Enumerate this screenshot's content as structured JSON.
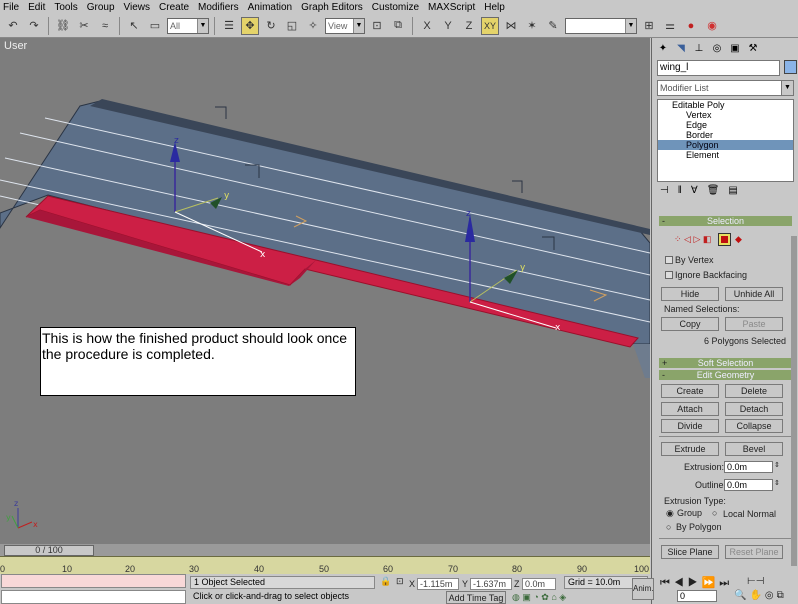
{
  "menu": [
    "File",
    "Edit",
    "Tools",
    "Group",
    "Views",
    "Create",
    "Modifiers",
    "Animation",
    "Graph Editors",
    "Customize",
    "MAXScript",
    "Help"
  ],
  "toolbar": {
    "selection_filter": "All",
    "ref_coord": "View",
    "named_selection": ""
  },
  "viewport": {
    "label": "User"
  },
  "note": {
    "text": "This is how the finished product should look once the procedure is completed."
  },
  "panel": {
    "object_name": "wing_l",
    "modifier_list": "Modifier List",
    "stack": [
      "Editable Poly",
      "Vertex",
      "Edge",
      "Border",
      "Polygon",
      "Element"
    ],
    "selection": {
      "title": "Selection",
      "by_vertex": "By Vertex",
      "ignore_backfacing": "Ignore Backfacing",
      "hide": "Hide",
      "unhide_all": "Unhide All",
      "named_selections": "Named Selections:",
      "copy": "Copy",
      "paste": "Paste",
      "status": "6 Polygons Selected"
    },
    "soft_selection": "Soft Selection",
    "edit_geometry": {
      "title": "Edit Geometry",
      "create": "Create",
      "delete": "Delete",
      "attach": "Attach",
      "detach": "Detach",
      "divide": "Divide",
      "collapse": "Collapse",
      "extrude": "Extrude",
      "bevel": "Bevel",
      "extrusion_label": "Extrusion:",
      "extrusion_value": "0.0m",
      "outline_label": "Outline",
      "outline_value": "0.0m",
      "extrusion_type": "Extrusion Type:",
      "group": "Group",
      "local_normal": "Local Normal",
      "by_polygon": "By Polygon",
      "slice_plane": "Slice Plane",
      "reset_plane": "Reset Plane"
    }
  },
  "timeline": {
    "slider": "0 / 100",
    "ticks": [
      "0",
      "10",
      "20",
      "30",
      "40",
      "50",
      "60",
      "70",
      "80",
      "90",
      "100"
    ]
  },
  "status": {
    "selected": "1 Object Selected",
    "prompt": "Click or click-and-drag to select objects",
    "x_label": "X",
    "x": "-1.115m",
    "y_label": "Y",
    "y": "-1.637m",
    "z_label": "Z",
    "z": "0.0m",
    "grid": "Grid = 10.0m",
    "add_time_tag": "Add Time Tag",
    "frame": "0",
    "anim": "Anim."
  }
}
